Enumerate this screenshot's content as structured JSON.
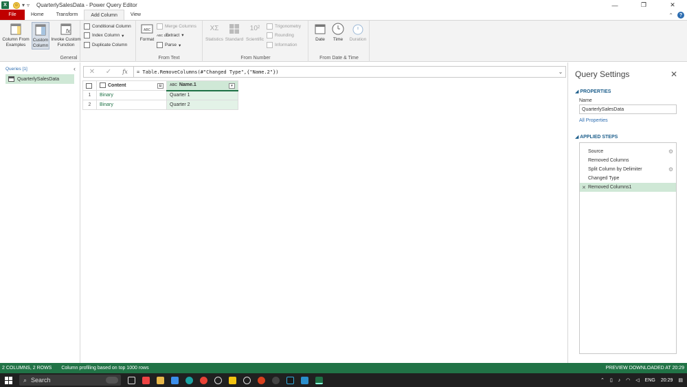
{
  "window": {
    "title": "QuarterlySalesData - Power Query Editor",
    "app_icon": "X",
    "controls": [
      "—",
      "❐",
      "✕"
    ]
  },
  "tabs": [
    {
      "label": "File"
    },
    {
      "label": "Home"
    },
    {
      "label": "Transform"
    },
    {
      "label": "Add Column"
    },
    {
      "label": "View"
    }
  ],
  "ribbon": {
    "general": {
      "label": "General",
      "column_from_examples": "Column From Examples",
      "custom_column": "Custom Column",
      "invoke_custom_function": "Invoke Custom Function",
      "conditional_column": "Conditional Column",
      "index_column": "Index Column",
      "duplicate_column": "Duplicate Column"
    },
    "from_text": {
      "label": "From Text",
      "format": "Format",
      "merge_columns": "Merge Columns",
      "extract": "Extract",
      "parse": "Parse",
      "abc": "ABC",
      "abc123": "ABC 123"
    },
    "from_number": {
      "label": "From Number",
      "statistics": "Statistics",
      "standard": "Standard",
      "scientific": "Scientific",
      "trigonometry": "Trigonometry",
      "rounding": "Rounding",
      "information": "Information",
      "sigma": "XΣ",
      "ten_sq": "10²"
    },
    "from_date_time": {
      "label": "From Date & Time",
      "date": "Date",
      "time": "Time",
      "duration": "Duration"
    }
  },
  "queries": {
    "header": "Queries [1]",
    "items": [
      "QuarterlySalesData"
    ]
  },
  "formula_bar": {
    "cancel": "✕",
    "confirm": "✓",
    "fx": "fx",
    "formula": "= Table.RemoveColumns(#\"Changed Type\",{\"Name.2\"})"
  },
  "grid": {
    "columns": [
      {
        "name": "Content",
        "type_label": ""
      },
      {
        "name": "Name.1",
        "type_label": "ABC"
      }
    ],
    "rows": [
      {
        "num": "1",
        "content": "Binary",
        "name1": "Quarter 1"
      },
      {
        "num": "2",
        "content": "Binary",
        "name1": "Quarter 2"
      }
    ]
  },
  "settings": {
    "title": "Query Settings",
    "properties_header": "PROPERTIES",
    "name_label": "Name",
    "name_value": "QuarterlySalesData",
    "all_properties": "All Properties",
    "applied_steps_header": "APPLIED STEPS",
    "steps": [
      {
        "label": "Source",
        "gear": true
      },
      {
        "label": "Removed Columns",
        "gear": false
      },
      {
        "label": "Split Column by Delimiter",
        "gear": true
      },
      {
        "label": "Changed Type",
        "gear": false
      },
      {
        "label": "Removed Columns1",
        "gear": false,
        "active": true
      }
    ]
  },
  "status": {
    "left1": "2 COLUMNS, 2 ROWS",
    "left2": "Column profiling based on top 1000 rows",
    "right": "PREVIEW DOWNLOADED AT 20:29"
  },
  "taskbar": {
    "search": "Search",
    "lang": "ENG",
    "time": "20:29"
  },
  "colors": {
    "excel_green": "#217346",
    "file_red": "#c00000",
    "selection_green": "#cfe8d6"
  }
}
